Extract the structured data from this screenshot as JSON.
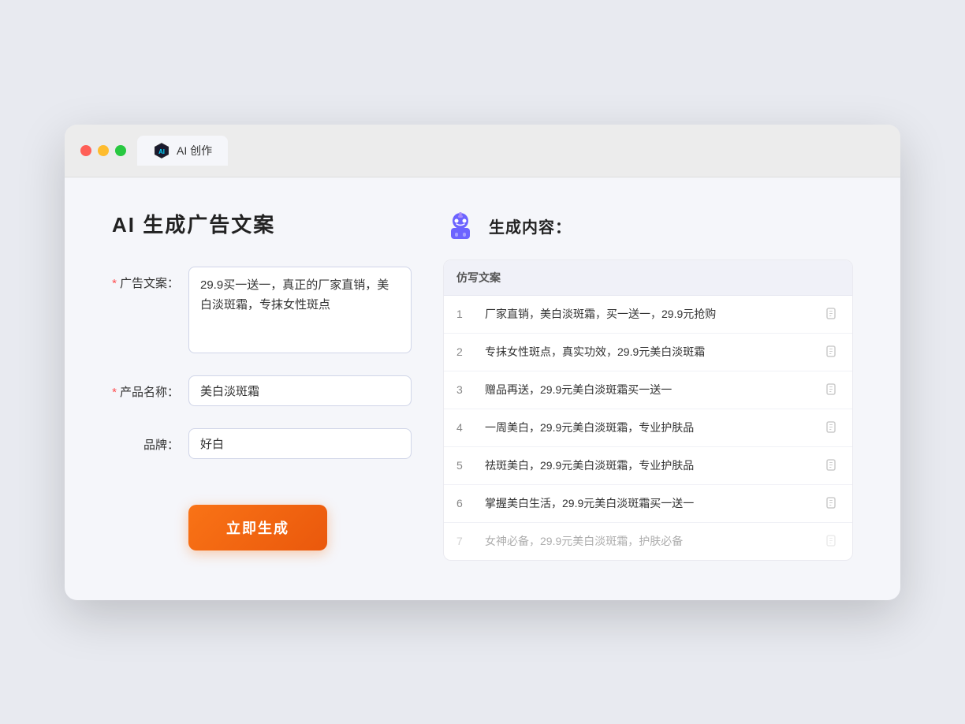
{
  "browser": {
    "tab_label": "AI 创作"
  },
  "page": {
    "title": "AI 生成广告文案",
    "right_title": "生成内容："
  },
  "form": {
    "ad_copy_label": "广告文案：",
    "ad_copy_required": "*",
    "ad_copy_value": "29.9买一送一，真正的厂家直销，美白淡斑霜，专抹女性斑点",
    "product_name_label": "产品名称：",
    "product_name_required": "*",
    "product_name_value": "美白淡斑霜",
    "brand_label": "品牌：",
    "brand_value": "好白",
    "generate_btn_label": "立即生成"
  },
  "table": {
    "header": "仿写文案",
    "rows": [
      {
        "num": "1",
        "text": "厂家直销，美白淡斑霜，买一送一，29.9元抢购",
        "faded": false
      },
      {
        "num": "2",
        "text": "专抹女性斑点，真实功效，29.9元美白淡斑霜",
        "faded": false
      },
      {
        "num": "3",
        "text": "赠品再送，29.9元美白淡斑霜买一送一",
        "faded": false
      },
      {
        "num": "4",
        "text": "一周美白，29.9元美白淡斑霜，专业护肤品",
        "faded": false
      },
      {
        "num": "5",
        "text": "祛斑美白，29.9元美白淡斑霜，专业护肤品",
        "faded": false
      },
      {
        "num": "6",
        "text": "掌握美白生活，29.9元美白淡斑霜买一送一",
        "faded": false
      },
      {
        "num": "7",
        "text": "女神必备，29.9元美白淡斑霜，护肤必备",
        "faded": true
      }
    ]
  }
}
